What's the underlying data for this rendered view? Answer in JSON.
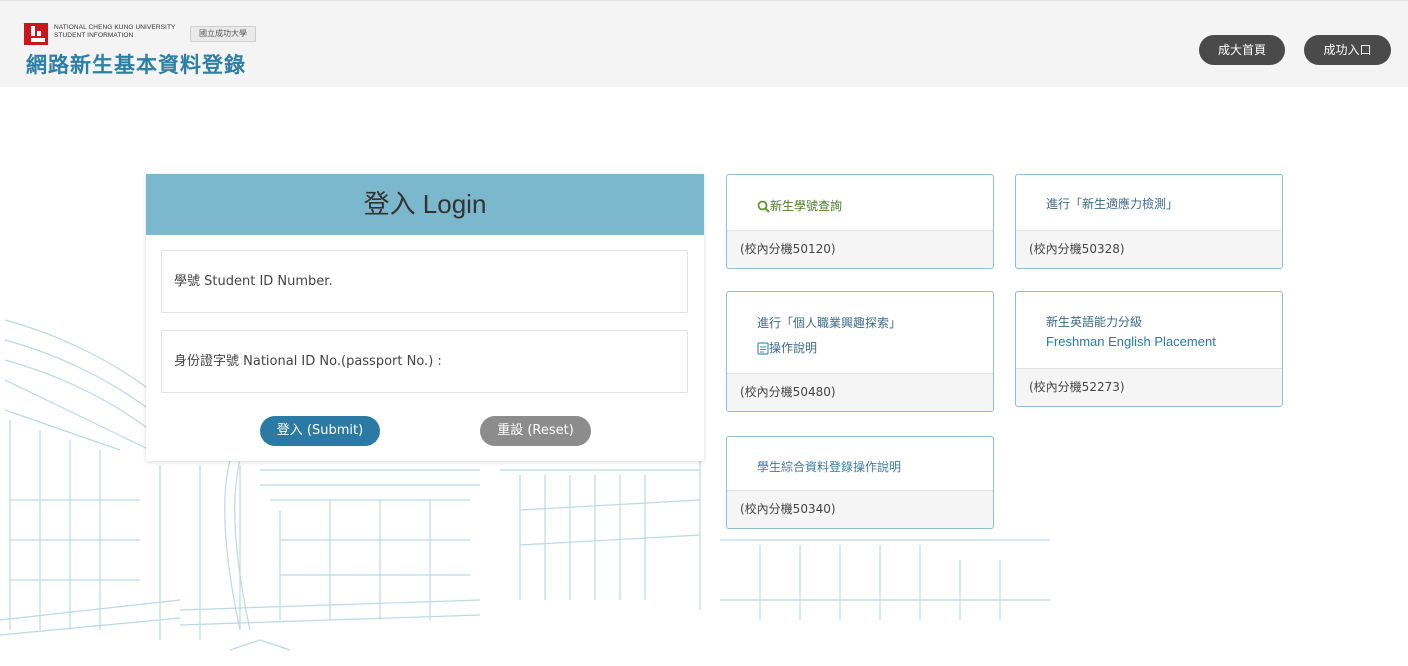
{
  "header": {
    "logo_en": [
      "NATIONAL CHENG KUNG UNIVERSITY",
      "STUDENT INFORMATION"
    ],
    "logo_seal": "國立成功大學",
    "site_title": "網路新生基本資料登錄",
    "nav_buttons": [
      {
        "label": "成大首頁"
      },
      {
        "label": "成功入口"
      }
    ]
  },
  "login": {
    "title": "登入 Login",
    "student_id_placeholder": "學號 Student ID Number.",
    "national_id_placeholder": "身份證字號 National ID No.(passport No.) :",
    "submit_label": "登入 (Submit)",
    "reset_label": "重設 (Reset)"
  },
  "cards": [
    {
      "link": "新生學號查詢",
      "icon": "search-icon",
      "ext": "(校內分機50120)"
    },
    {
      "link": "進行「新生適應力檢測」",
      "ext": "(校內分機50328)"
    },
    {
      "link": "進行「個人職業興趣探索」",
      "sub_link": "操作說明",
      "sub_icon": "document-icon",
      "ext": "(校內分機50480)"
    },
    {
      "link": "新生英語能力分級",
      "link2": "Freshman English Placement",
      "ext": "(校內分機52273)"
    },
    {
      "link": "學生綜合資料登錄操作說明",
      "ext": "(校內分機50340)"
    }
  ],
  "colors": {
    "accent": "#2b7aa3",
    "login_header": "#7cb8cd",
    "card_border": "#8ebfd4",
    "nav_button": "#4a4a4a",
    "reset_button": "#8c8c8c"
  }
}
